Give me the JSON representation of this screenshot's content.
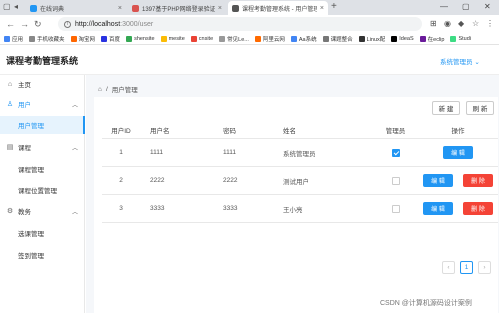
{
  "browser": {
    "tabs": [
      {
        "title": "在线词典",
        "favcolor": "#2196f3"
      },
      {
        "title": "1397基于PHP网络登录验证系...",
        "favcolor": "#d9534f"
      },
      {
        "title": "课程考勤管理系统 - 用户管理",
        "favcolor": "#555555"
      }
    ],
    "url_host": "http://localhost",
    "url_path": ":3000/user",
    "bookmarks": [
      {
        "label": "应用",
        "color": "#4285f4"
      },
      {
        "label": "手机收藏夹",
        "color": "#888888"
      },
      {
        "label": "淘宝网",
        "color": "#ff6600"
      },
      {
        "label": "百度",
        "color": "#2932e1"
      },
      {
        "label": "shensite",
        "color": "#34a853"
      },
      {
        "label": "mesite",
        "color": "#fbbc05"
      },
      {
        "label": "cnsite",
        "color": "#ea4335"
      },
      {
        "label": "常见Le...",
        "color": "#999999"
      },
      {
        "label": "阿里云网",
        "color": "#ff6a00"
      },
      {
        "label": "Aa系统",
        "color": "#4285f4"
      },
      {
        "label": "课题整合",
        "color": "#777777"
      },
      {
        "label": "Linux配",
        "color": "#333333"
      },
      {
        "label": "IdeaS",
        "color": "#000000"
      },
      {
        "label": "在eclip",
        "color": "#6a1b9a"
      },
      {
        "label": "Studi",
        "color": "#3ddc84"
      }
    ]
  },
  "header": {
    "title": "课程考勤管理系统",
    "user_menu": "系统管理员"
  },
  "sidebar": {
    "items": [
      {
        "label": "主页",
        "icon": "home-icon"
      },
      {
        "label": "用户",
        "icon": "user-icon"
      },
      {
        "label": "用户管理"
      },
      {
        "label": "课程",
        "icon": "document-icon"
      },
      {
        "label": "课程管理"
      },
      {
        "label": "课程位置管理"
      },
      {
        "label": "教务",
        "icon": "gear-icon"
      },
      {
        "label": "选课管理"
      },
      {
        "label": "签到管理"
      }
    ]
  },
  "breadcrumb": {
    "current": "用户管理"
  },
  "toolbar": {
    "new_label": "新 建",
    "refresh_label": "刷 新"
  },
  "table": {
    "headers": [
      "用户ID",
      "用户名",
      "密码",
      "姓名",
      "管理员",
      "操作"
    ],
    "rows": [
      {
        "id": "1",
        "username": "1111",
        "password": "1111",
        "name": "系统管理员",
        "admin": true
      },
      {
        "id": "2",
        "username": "2222",
        "password": "2222",
        "name": "测试用户",
        "admin": false
      },
      {
        "id": "3",
        "username": "3333",
        "password": "3333",
        "name": "王小亮",
        "admin": false
      }
    ],
    "edit_label": "编 辑",
    "delete_label": "删 除"
  },
  "pagination": {
    "current": "1",
    "prev": "‹",
    "next": "›"
  },
  "watermark": "CSDN @计算机源码设计案例"
}
